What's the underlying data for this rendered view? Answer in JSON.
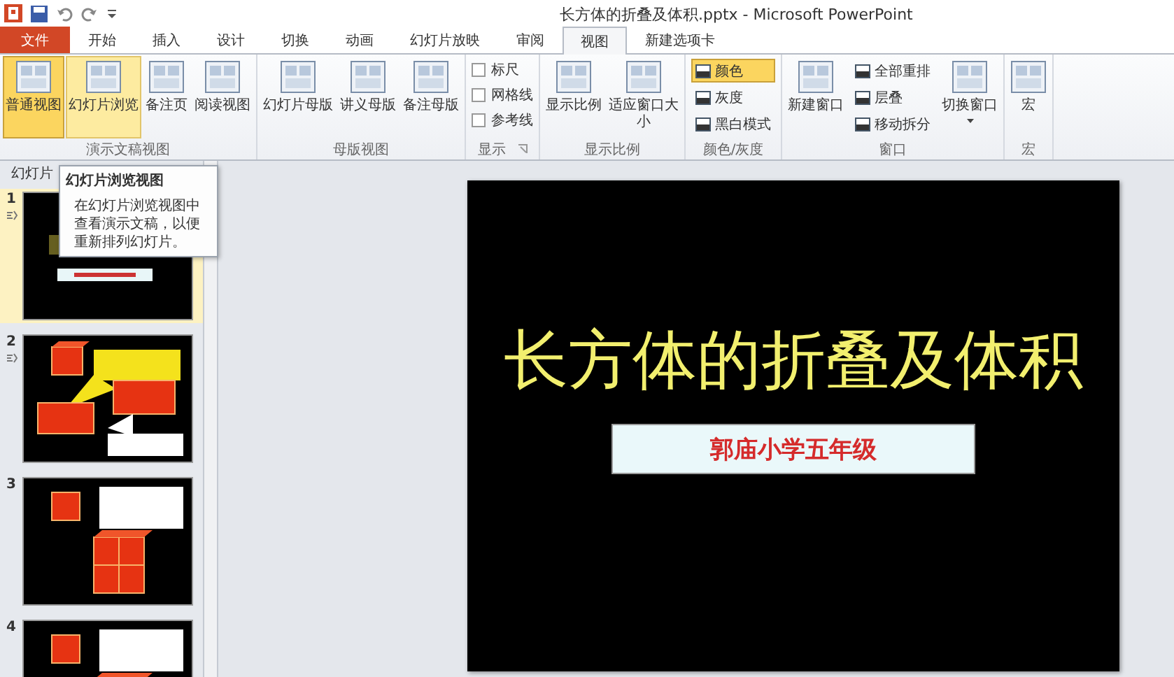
{
  "window": {
    "title": "长方体的折叠及体积.pptx - Microsoft PowerPoint"
  },
  "tabs": [
    {
      "label": "文件",
      "kind": "file"
    },
    {
      "label": "开始",
      "kind": "tab",
      "selected": false
    },
    {
      "label": "插入",
      "kind": "tab",
      "selected": false
    },
    {
      "label": "设计",
      "kind": "tab",
      "selected": false
    },
    {
      "label": "切换",
      "kind": "tab",
      "selected": false
    },
    {
      "label": "动画",
      "kind": "tab",
      "selected": false
    },
    {
      "label": "幻灯片放映",
      "kind": "tab",
      "selected": false
    },
    {
      "label": "审阅",
      "kind": "tab",
      "selected": false
    },
    {
      "label": "视图",
      "kind": "tab",
      "selected": true
    },
    {
      "label": "新建选项卡",
      "kind": "tab",
      "selected": false
    }
  ],
  "ribbon": {
    "groups": [
      {
        "label": "演示文稿视图",
        "items": [
          {
            "kind": "large",
            "label": "普通视图",
            "selected": true,
            "hovered": false
          },
          {
            "kind": "large",
            "label": "幻灯片浏览",
            "selected": false,
            "hovered": true
          },
          {
            "kind": "large",
            "label": "备注页",
            "selected": false,
            "hovered": false
          },
          {
            "kind": "large",
            "label": "阅读视图",
            "selected": false,
            "hovered": false
          }
        ]
      },
      {
        "label": "母版视图",
        "items": [
          {
            "kind": "large",
            "label": "幻灯片母版",
            "selected": false,
            "hovered": false
          },
          {
            "kind": "large",
            "label": "讲义母版",
            "selected": false,
            "hovered": false
          },
          {
            "kind": "large",
            "label": "备注母版",
            "selected": false,
            "hovered": false
          }
        ]
      },
      {
        "label": "显示",
        "launcher": true,
        "items": [
          {
            "kind": "check",
            "label": "标尺",
            "checked": false
          },
          {
            "kind": "check",
            "label": "网格线",
            "checked": false
          },
          {
            "kind": "check",
            "label": "参考线",
            "checked": false
          }
        ]
      },
      {
        "label": "显示比例",
        "items": [
          {
            "kind": "large",
            "label": "显示比例",
            "selected": false,
            "hovered": false
          },
          {
            "kind": "large",
            "label": "适应窗口大小",
            "selected": false,
            "hovered": false
          }
        ]
      },
      {
        "label": "颜色/灰度",
        "items": [
          {
            "kind": "small",
            "label": "颜色",
            "selected": true
          },
          {
            "kind": "small",
            "label": "灰度",
            "selected": false
          },
          {
            "kind": "small",
            "label": "黑白模式",
            "selected": false
          }
        ]
      },
      {
        "label": "窗口",
        "items": [
          {
            "kind": "large",
            "label": "新建窗口",
            "selected": false,
            "hovered": false
          },
          {
            "kind": "small",
            "label": "全部重排",
            "selected": false
          },
          {
            "kind": "small",
            "label": "层叠",
            "selected": false
          },
          {
            "kind": "small",
            "label": "移动拆分",
            "selected": false
          },
          {
            "kind": "dropdown",
            "label": "切换窗口",
            "selected": false,
            "hovered": false
          }
        ]
      },
      {
        "label": "宏",
        "items": [
          {
            "kind": "large",
            "label": "宏",
            "selected": false,
            "hovered": false
          }
        ]
      }
    ]
  },
  "slides_pane": {
    "tab_label": "幻灯片",
    "slides": [
      {
        "number": "1",
        "kind": "title",
        "selected": true,
        "animated": true
      },
      {
        "number": "2",
        "kind": "cubes",
        "selected": false,
        "animated": true
      },
      {
        "number": "3",
        "kind": "cube-stack",
        "selected": false,
        "animated": false
      },
      {
        "number": "4",
        "kind": "cube-stack",
        "selected": false,
        "animated": false
      }
    ]
  },
  "tooltip": {
    "title": "幻灯片浏览视图",
    "text": "在幻灯片浏览视图中查看演示文稿，以便重新排列幻灯片。"
  },
  "slide": {
    "title": "长方体的折叠及体积",
    "subtitle": "郭庙小学五年级"
  }
}
